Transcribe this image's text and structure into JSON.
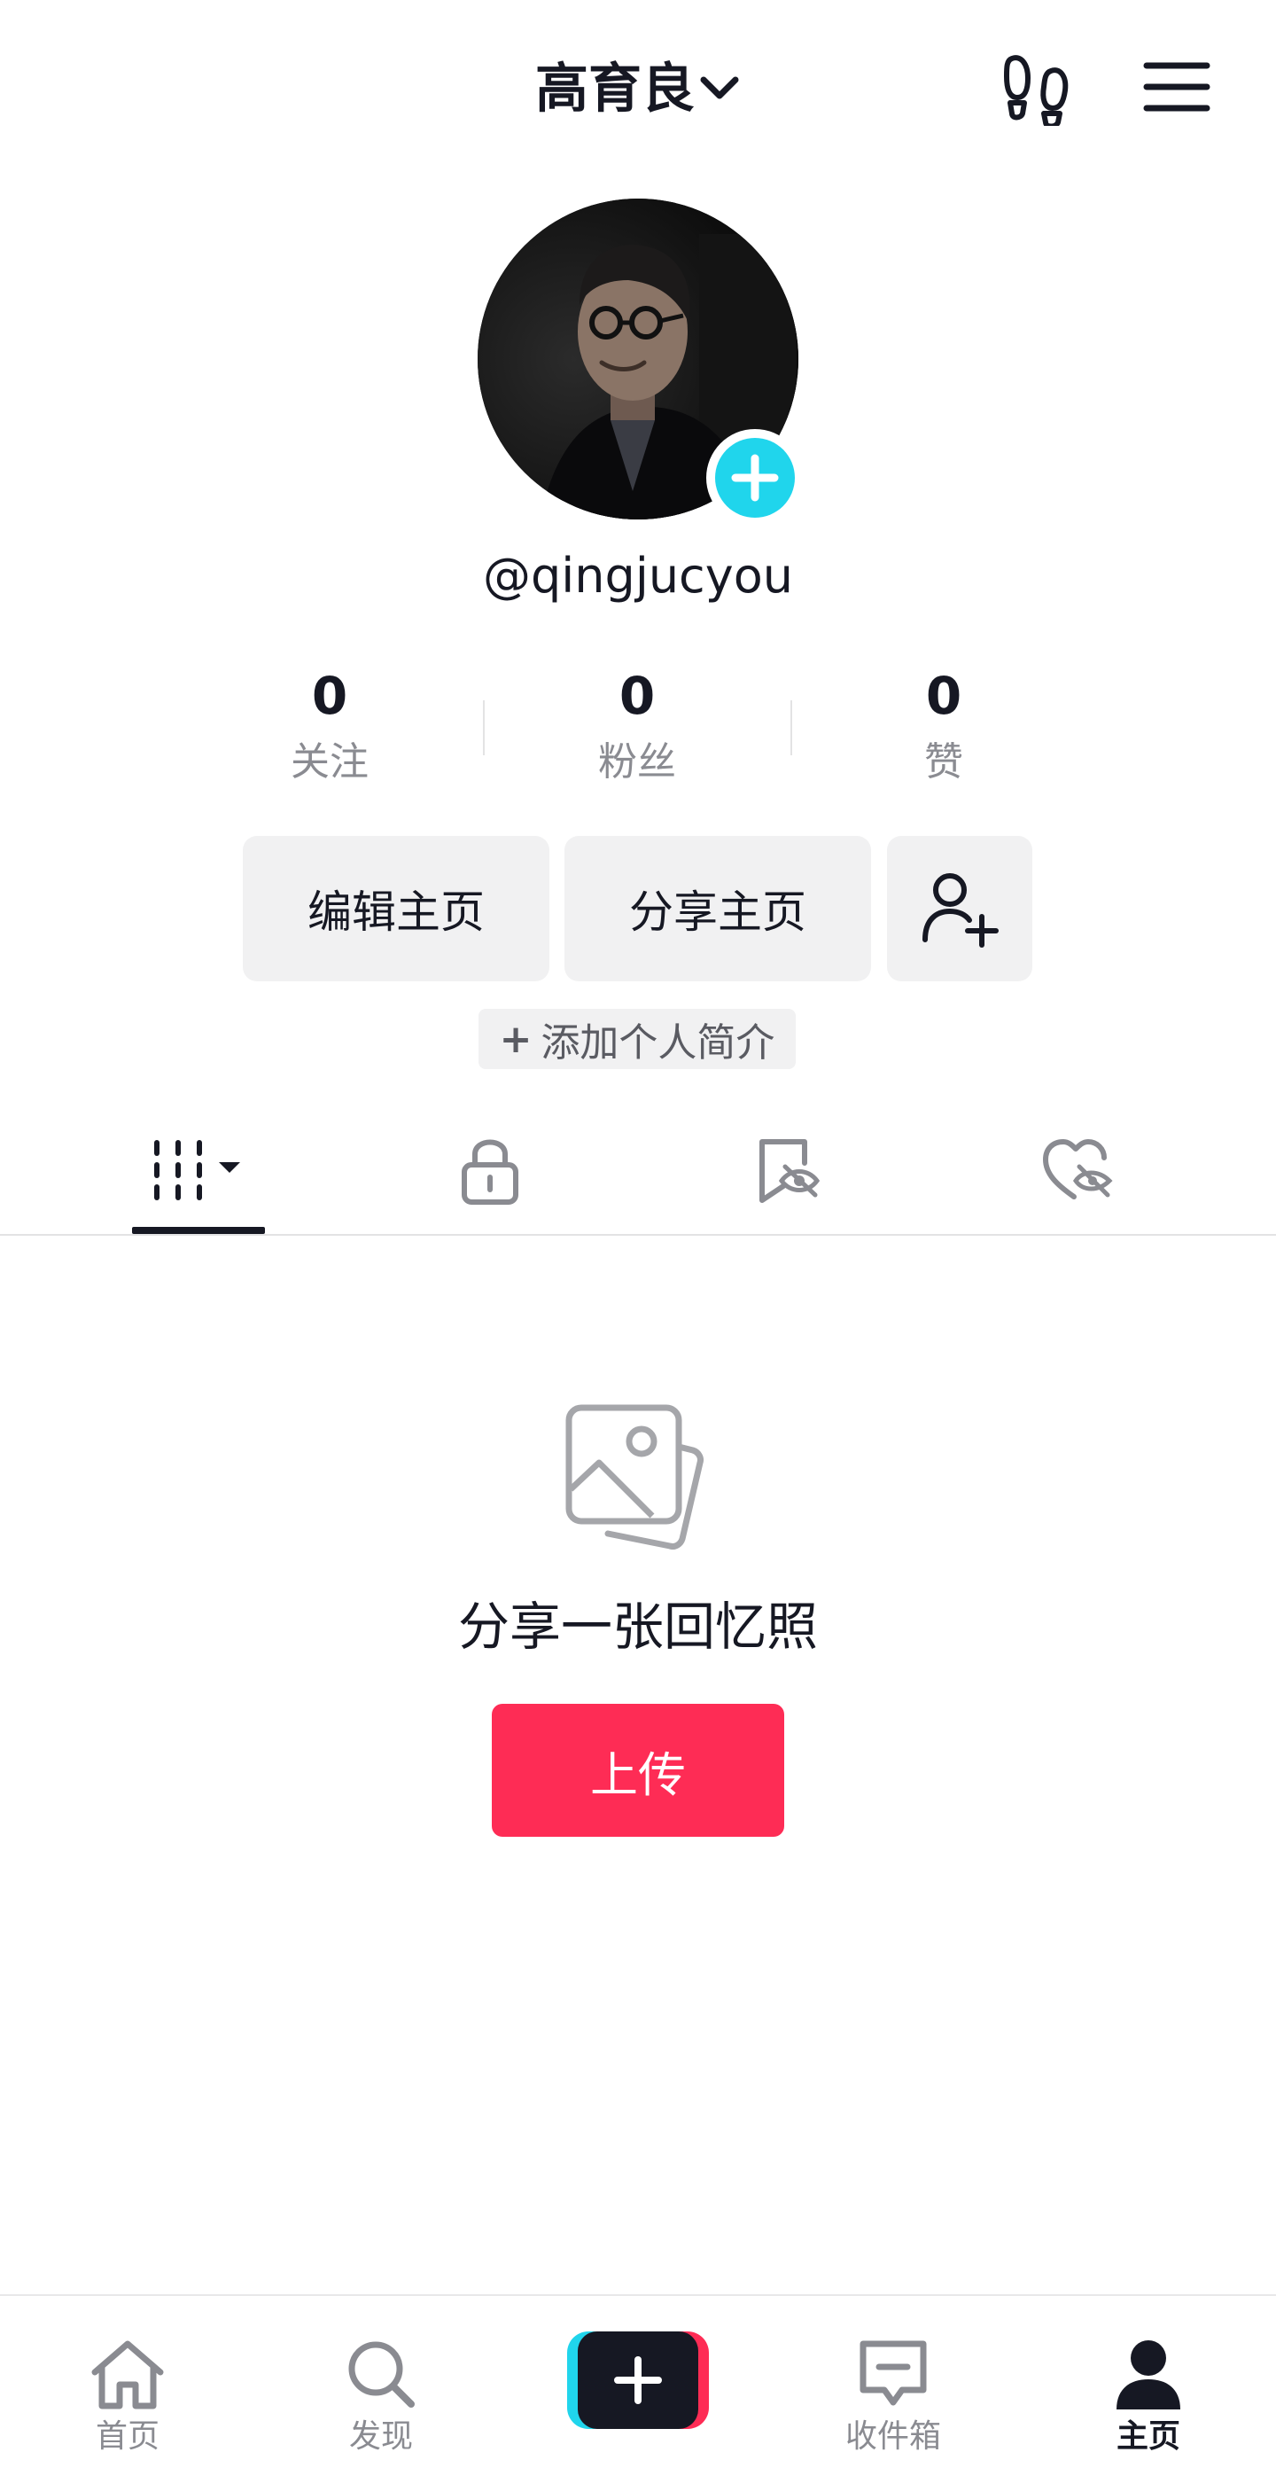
{
  "header": {
    "title": "高育良",
    "dropdown_icon": "chevron-down-icon",
    "footprints_icon": "footprints-icon",
    "menu_icon": "hamburger-menu-icon"
  },
  "profile": {
    "username": "@qingjucyou",
    "avatar_add_icon": "plus-icon"
  },
  "stats": [
    {
      "value": "0",
      "label": "关注"
    },
    {
      "value": "0",
      "label": "粉丝"
    },
    {
      "value": "0",
      "label": "赞"
    }
  ],
  "actions": {
    "edit_label": "编辑主页",
    "share_label": "分享主页",
    "add_friend_icon": "add-user-icon"
  },
  "bio": {
    "plus": "+",
    "label": "添加个人简介"
  },
  "tabs": [
    {
      "icon": "grid-icon",
      "active": true
    },
    {
      "icon": "lock-icon",
      "active": false
    },
    {
      "icon": "bookmark-hidden-icon",
      "active": false
    },
    {
      "icon": "heart-hidden-icon",
      "active": false
    }
  ],
  "empty_state": {
    "icon": "photos-icon",
    "title": "分享一张回忆照",
    "button": "上传"
  },
  "bottom_nav": {
    "items": [
      {
        "label": "首页",
        "icon": "home-icon"
      },
      {
        "label": "发现",
        "icon": "search-icon"
      },
      {
        "label": "收件箱",
        "icon": "inbox-icon"
      },
      {
        "label": "主页",
        "icon": "profile-icon",
        "active": true
      }
    ],
    "create_icon": "plus-icon"
  },
  "colors": {
    "accent": "#fe2c55",
    "cyan": "#20d5ec",
    "text": "#161823",
    "muted": "#8a8b91",
    "button_bg": "#f1f1f2"
  }
}
